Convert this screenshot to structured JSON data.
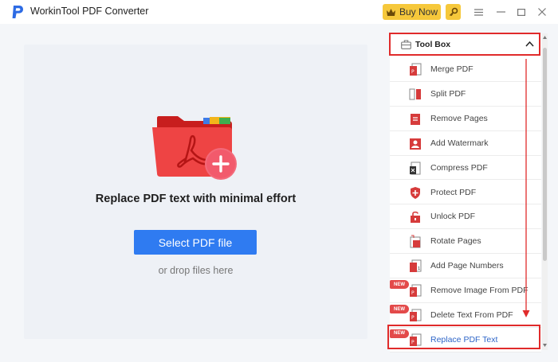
{
  "app": {
    "title": "WorkinTool PDF Converter"
  },
  "header": {
    "buy_label": "Buy Now"
  },
  "main": {
    "headline": "Replace PDF text with minimal effort",
    "select_label": "Select PDF file",
    "drop_hint": "or drop files here"
  },
  "toolbox": {
    "title": "Tool Box",
    "items": [
      {
        "label": "Merge PDF",
        "icon": "merge-pdf-icon",
        "new": false
      },
      {
        "label": "Split PDF",
        "icon": "split-pdf-icon",
        "new": false
      },
      {
        "label": "Remove Pages",
        "icon": "remove-pages-icon",
        "new": false
      },
      {
        "label": "Add Watermark",
        "icon": "watermark-icon",
        "new": false
      },
      {
        "label": "Compress PDF",
        "icon": "compress-pdf-icon",
        "new": false
      },
      {
        "label": "Protect PDF",
        "icon": "shield-icon",
        "new": false
      },
      {
        "label": "Unlock PDF",
        "icon": "unlock-icon",
        "new": false
      },
      {
        "label": "Rotate Pages",
        "icon": "rotate-icon",
        "new": false
      },
      {
        "label": "Add Page Numbers",
        "icon": "page-numbers-icon",
        "new": false
      },
      {
        "label": "Remove Image From PDF",
        "icon": "remove-image-icon",
        "new": true
      },
      {
        "label": "Delete Text From PDF",
        "icon": "delete-text-icon",
        "new": true
      },
      {
        "label": "Replace PDF Text",
        "icon": "replace-text-icon",
        "new": true
      }
    ],
    "new_badge": "NEW"
  },
  "colors": {
    "accent": "#2f7bf1",
    "brand_red": "#e02b2b",
    "buy_yellow": "#f6c83b",
    "active_text": "#2f66c8"
  }
}
